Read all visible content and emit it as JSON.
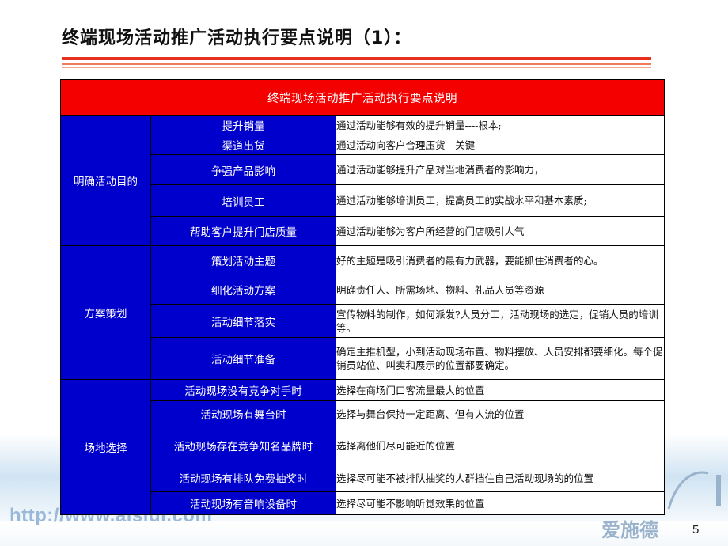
{
  "slide": {
    "title": "终端现场活动推广活动执行要点说明（1）：",
    "page_number": "5",
    "footer_url": "http://www.aisidi.com",
    "footer_logo_text": "爱施德",
    "colors": {
      "header_red": "#f40000",
      "cell_blue": "#0000cc",
      "rule_red": "#e8301e"
    }
  },
  "table": {
    "header": "终端现场活动推广活动执行要点说明",
    "groups": [
      {
        "label": "明确活动目的",
        "rows": [
          {
            "item": "提升销量",
            "desc": "通过活动能够有效的提升销量----根本;"
          },
          {
            "item": "渠道出货",
            "desc": "通过活动向客户合理压货---关键"
          },
          {
            "item": "争强产品影响",
            "desc": "通过活动能够提升产品对当地消费者的影响力，"
          },
          {
            "item": "培训员工",
            "desc": "通过活动能够培训员工，提高员工的实战水平和基本素质;"
          },
          {
            "item": "帮助客户提升门店质量",
            "desc": "通过活动能够为客户所经营的门店吸引人气"
          }
        ]
      },
      {
        "label": "方案策划",
        "rows": [
          {
            "item": "策划活动主题",
            "desc": "好的主题是吸引消费者的最有力武器，要能抓住消费者的心。"
          },
          {
            "item": "细化活动方案",
            "desc": "明确责任人、所需场地、物料、礼品人员等资源"
          },
          {
            "item": "活动细节落实",
            "desc": "宣传物料的制作，如何派发?人员分工，活动现场的选定，促销人员的培训等。"
          },
          {
            "item": "活动细节准备",
            "desc": "确定主推机型，小到活动现场布置、物料摆放、人员安排都要细化。每个促销员站位、叫卖和展示的位置都要确定。"
          }
        ]
      },
      {
        "label": "场地选择",
        "rows": [
          {
            "item": "活动现场没有竞争对手时",
            "desc": "选择在商场门口客流量最大的位置"
          },
          {
            "item": "活动现场有舞台时",
            "desc": "选择与舞台保持一定距离、但有人流的位置"
          },
          {
            "item": "活动现场存在竞争知名品牌时",
            "desc": "选择离他们尽可能近的位置"
          },
          {
            "item": "活动现场有排队免费抽奖时",
            "desc": "选择尽可能不被排队抽奖的人群挡住自己活动现场的的位置"
          },
          {
            "item": "活动现场有音响设备时",
            "desc": "选择尽可能不影响听觉效果的位置"
          }
        ]
      }
    ]
  }
}
